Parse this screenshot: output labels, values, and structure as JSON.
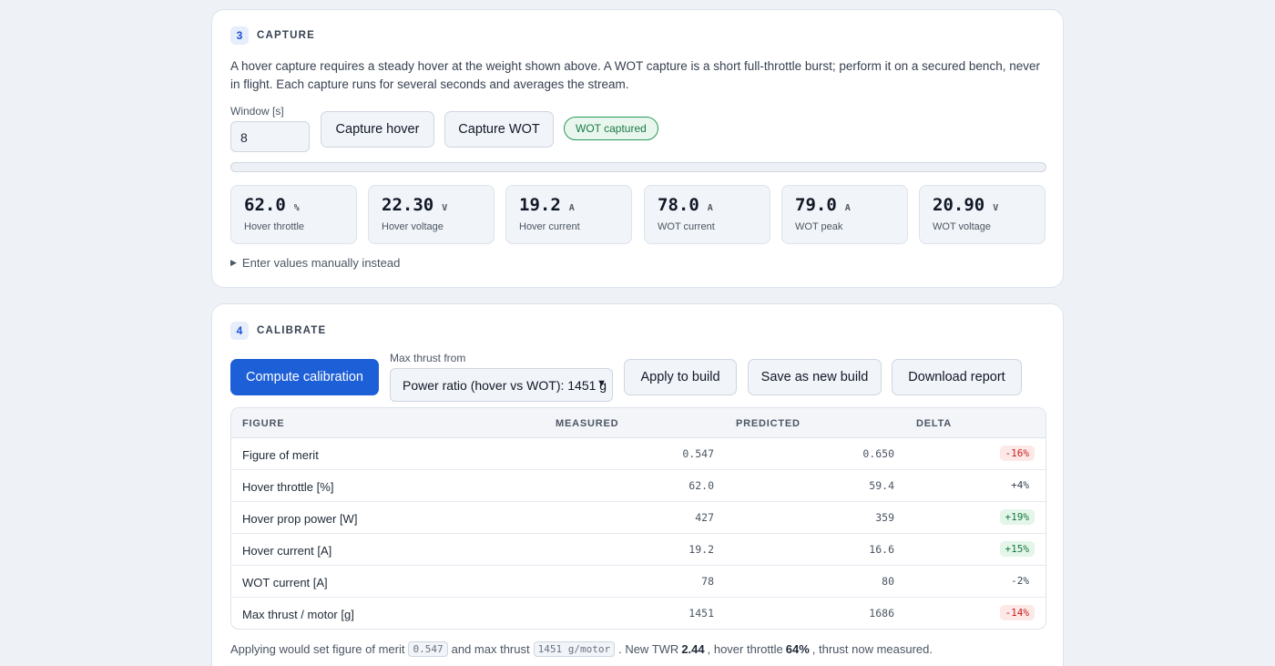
{
  "capture": {
    "step_number": "3",
    "step_title": "CAPTURE",
    "description": "A hover capture requires a steady hover at the weight shown above. A WOT capture is a short full-throttle burst; perform it on a secured bench, never in flight. Each capture runs for several seconds and averages the stream.",
    "window_label": "Window [s]",
    "window_value": "8",
    "capture_hover_label": "Capture hover",
    "capture_wot_label": "Capture WOT",
    "status_badge": "WOT captured",
    "progress": 0,
    "metrics": [
      {
        "value": "62.0",
        "unit": "%",
        "label": "Hover throttle"
      },
      {
        "value": "22.30",
        "unit": "V",
        "label": "Hover voltage"
      },
      {
        "value": "19.2",
        "unit": "A",
        "label": "Hover current"
      },
      {
        "value": "78.0",
        "unit": "A",
        "label": "WOT current"
      },
      {
        "value": "79.0",
        "unit": "A",
        "label": "WOT peak"
      },
      {
        "value": "20.90",
        "unit": "V",
        "label": "WOT voltage"
      }
    ],
    "manual_toggle": "Enter values manually instead"
  },
  "calibrate": {
    "step_number": "4",
    "step_title": "CALIBRATE",
    "compute_label": "Compute calibration",
    "max_thrust_label": "Max thrust from",
    "max_thrust_selected": "Power ratio (hover vs WOT): 1451 g",
    "apply_label": "Apply to build",
    "save_label": "Save as new build",
    "download_label": "Download report",
    "table": {
      "headers": [
        "FIGURE",
        "MEASURED",
        "PREDICTED",
        "DELTA"
      ],
      "rows": [
        {
          "figure": "Figure of merit",
          "measured": "0.547",
          "predicted": "0.650",
          "delta": "-16%",
          "tone": "neg"
        },
        {
          "figure": "Hover throttle [%]",
          "measured": "62.0",
          "predicted": "59.4",
          "delta": "+4%",
          "tone": "plain"
        },
        {
          "figure": "Hover prop power [W]",
          "measured": "427",
          "predicted": "359",
          "delta": "+19%",
          "tone": "pos"
        },
        {
          "figure": "Hover current [A]",
          "measured": "19.2",
          "predicted": "16.6",
          "delta": "+15%",
          "tone": "pos"
        },
        {
          "figure": "WOT current [A]",
          "measured": "78",
          "predicted": "80",
          "delta": "-2%",
          "tone": "plain"
        },
        {
          "figure": "Max thrust / motor [g]",
          "measured": "1451",
          "predicted": "1686",
          "delta": "-14%",
          "tone": "neg"
        }
      ]
    },
    "summary": {
      "part1": "Applying would set figure of merit",
      "fom_code": "0.547",
      "part2": "and max thrust",
      "thrust_code": "1451 g/motor",
      "part3": ". New TWR",
      "twr": "2.44",
      "part4": ", hover throttle",
      "hover_throttle": "64%",
      "part5": ", thrust now measured."
    }
  },
  "colors": {
    "accent": "#1d5fd6",
    "success": "#1b7a45",
    "danger": "#c81e1e",
    "background": "#eef1f6"
  }
}
